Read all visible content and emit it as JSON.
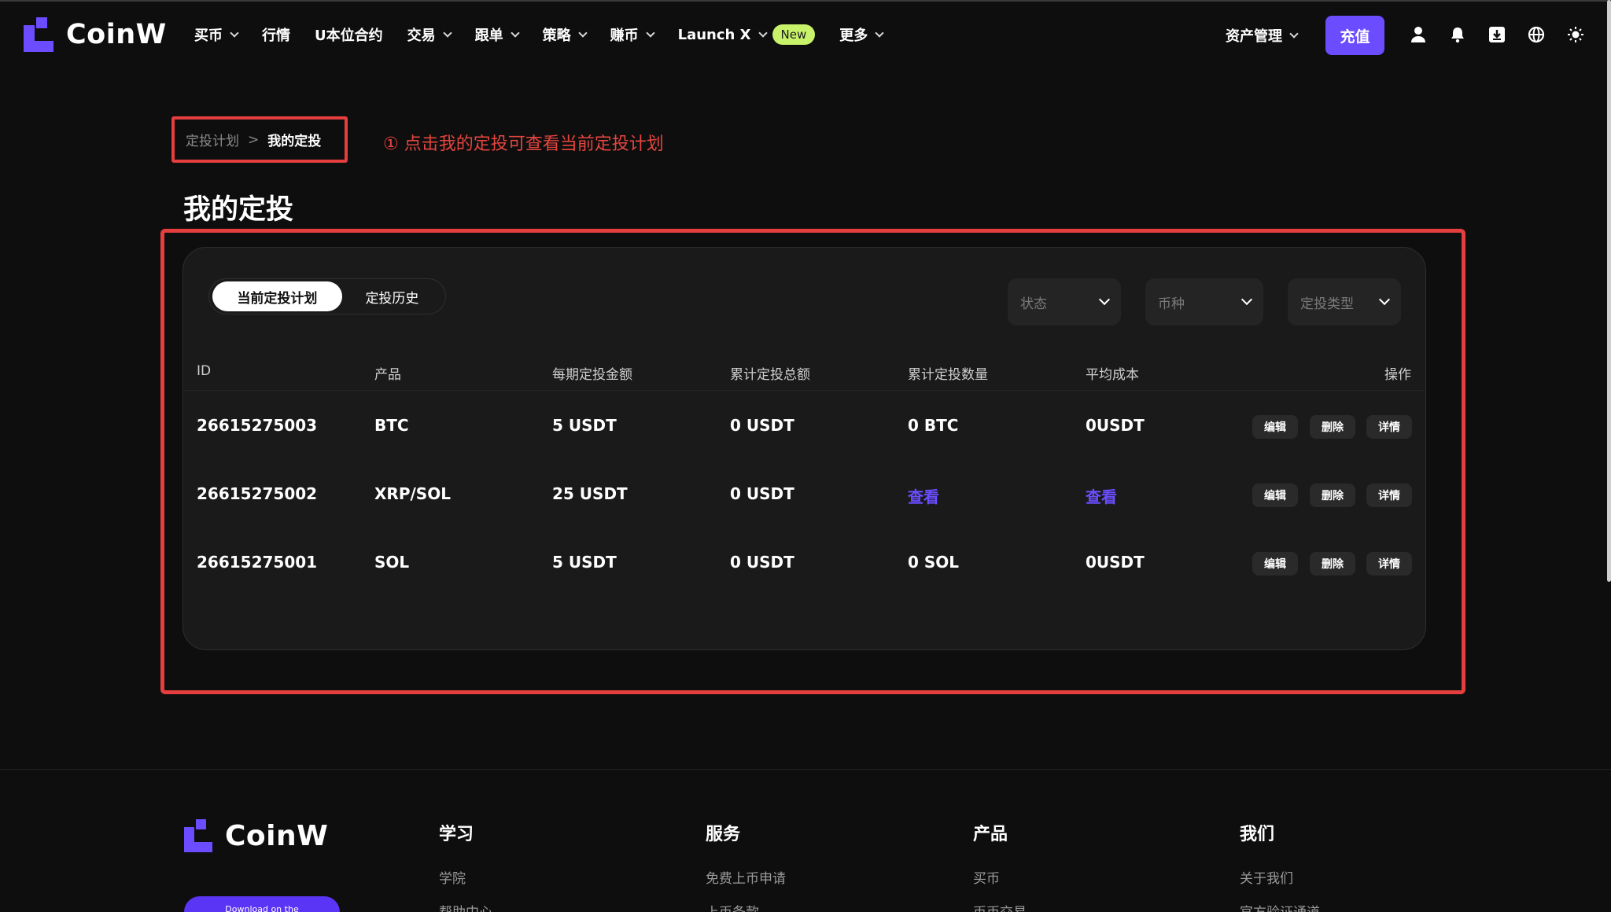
{
  "header": {
    "logo_text": "CoinW",
    "nav": [
      {
        "label": "买币",
        "dropdown": true
      },
      {
        "label": "行情",
        "dropdown": false
      },
      {
        "label": "U本位合约",
        "dropdown": false
      },
      {
        "label": "交易",
        "dropdown": true
      },
      {
        "label": "跟单",
        "dropdown": true
      },
      {
        "label": "策略",
        "dropdown": true
      },
      {
        "label": "赚币",
        "dropdown": true
      },
      {
        "label": "Launch X",
        "dropdown": true,
        "badge": "New"
      },
      {
        "label": "更多",
        "dropdown": true
      }
    ],
    "asset_label": "资产管理",
    "deposit_label": "充值",
    "icons": [
      "user-icon",
      "bell-icon",
      "download-icon",
      "globe-icon",
      "sun-icon"
    ]
  },
  "breadcrumb": {
    "prev": "定投计划",
    "separator": ">",
    "current": "我的定投"
  },
  "annotation": "① 点击我的定投可查看当前定投计划",
  "page_title": "我的定投",
  "tabs": {
    "active": "当前定投计划",
    "inactive": "定投历史"
  },
  "filters": {
    "status": "状态",
    "coin": "币种",
    "type": "定投类型"
  },
  "table": {
    "headers": [
      "ID",
      "产品",
      "每期定投金额",
      "累计定投总额",
      "累计定投数量",
      "平均成本",
      "操作"
    ],
    "rows": [
      {
        "id": "26615275003",
        "product": "BTC",
        "per_period": "5 USDT",
        "total_amount": "0 USDT",
        "total_qty": "0 BTC",
        "avg_cost": "0USDT",
        "qty_link": false,
        "cost_link": false
      },
      {
        "id": "26615275002",
        "product": "XRP/SOL",
        "per_period": "25 USDT",
        "total_amount": "0 USDT",
        "total_qty": "查看",
        "avg_cost": "查看",
        "qty_link": true,
        "cost_link": true
      },
      {
        "id": "26615275001",
        "product": "SOL",
        "per_period": "5 USDT",
        "total_amount": "0 USDT",
        "total_qty": "0 SOL",
        "avg_cost": "0USDT",
        "qty_link": false,
        "cost_link": false
      }
    ],
    "actions": {
      "edit": "编辑",
      "delete": "删除",
      "detail": "详情"
    }
  },
  "footer": {
    "logo_text": "CoinW",
    "columns": [
      {
        "title": "学习",
        "items": [
          "学院",
          "帮助中心"
        ]
      },
      {
        "title": "服务",
        "items": [
          "免费上币申请",
          "上币条款"
        ]
      },
      {
        "title": "产品",
        "items": [
          "买币",
          "币币交易"
        ]
      },
      {
        "title": "我们",
        "items": [
          "关于我们",
          "官方验证通道"
        ]
      }
    ],
    "download_label": "Download on the"
  },
  "colors": {
    "accent": "#6b4dff",
    "highlight": "#e53e3e",
    "new_badge": "#c8f26a"
  }
}
